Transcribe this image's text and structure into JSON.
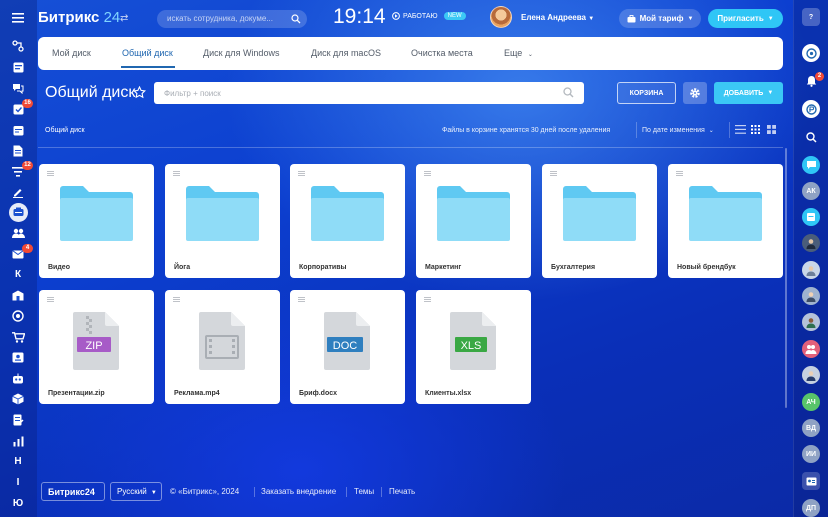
{
  "header": {
    "logo_text": "Битрикс",
    "logo_num": "24",
    "search_placeholder": "искать сотрудника, докуме...",
    "clock": "19:14",
    "work_status": "РАБОТАЮ",
    "new_badge": "NEW",
    "user_name": "Елена Андреева",
    "tariff_label": "Мой тариф",
    "invite_label": "Пригласить"
  },
  "left_sidebar": {
    "badges": {
      "tasks": "16",
      "feed": "12",
      "mail": "4"
    },
    "letters": {
      "k": "К",
      "n": "Н",
      "i": "I",
      "yu": "Ю"
    }
  },
  "right_sidebar": {
    "notification_badge": "2",
    "contacts": {
      "ak": "АК",
      "ach": "АЧ",
      "vd": "ВД",
      "ii": "ИИ",
      "dp": "ДП"
    }
  },
  "tabs": [
    {
      "label": "Мой диск"
    },
    {
      "label": "Общий диск"
    },
    {
      "label": "Диск для Windows"
    },
    {
      "label": "Диск для macOS"
    },
    {
      "label": "Очистка места"
    },
    {
      "label": "Еще"
    }
  ],
  "toolbar": {
    "title": "Общий диск",
    "filter_placeholder": "Фильтр + поиск",
    "trash_label": "КОРЗИНА",
    "add_label": "ДОБАВИТЬ"
  },
  "info_bar": {
    "breadcrumb": "Общий диск",
    "retention_note": "Файлы в корзине хранятся 30 дней после удаления",
    "sort_label": "По дате изменения"
  },
  "folders": [
    {
      "name": "Видео"
    },
    {
      "name": "Йога"
    },
    {
      "name": "Корпоративы"
    },
    {
      "name": "Маркетинг"
    },
    {
      "name": "Бухгалтерия"
    },
    {
      "name": "Новый брендбук"
    }
  ],
  "files": [
    {
      "name": "Презентации.zip",
      "ext": "ZIP",
      "color": "#a75bc7"
    },
    {
      "name": "Реклама.mp4",
      "ext": "",
      "color": "#b9bec4"
    },
    {
      "name": "Бриф.docx",
      "ext": "DOC",
      "color": "#2f7fbf"
    },
    {
      "name": "Клиенты.xlsx",
      "ext": "XLS",
      "color": "#3aa844"
    }
  ],
  "footer": {
    "logo": "Битрикс24",
    "language": "Русский",
    "copyright": "© «Битрикс», 2024",
    "order_link": "Заказать внедрение",
    "themes_link": "Темы",
    "print_link": "Печать"
  },
  "colors": {
    "accent": "#3bc8f5",
    "tab_active": "#2067b0",
    "folder": "#5fc9f2",
    "badge": "#f24a36"
  }
}
